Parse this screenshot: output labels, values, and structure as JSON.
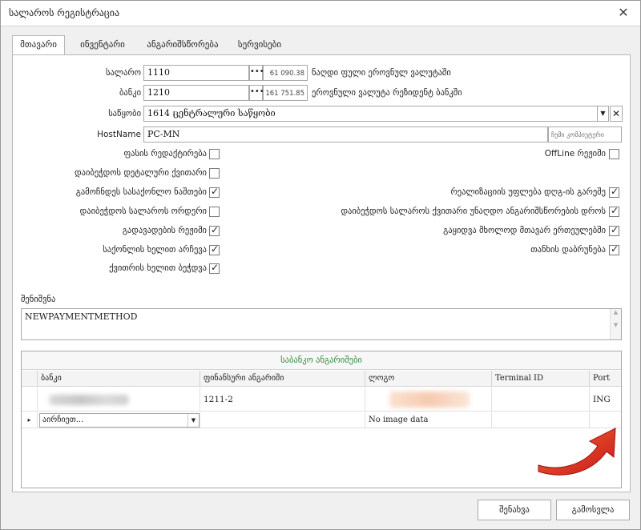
{
  "window": {
    "title": "სალაროს რეგისტრაცია",
    "close_glyph": "✕"
  },
  "tabs": [
    {
      "label": "მთავარი"
    },
    {
      "label": "ინვენტარი"
    },
    {
      "label": "ანგარიშსწორება"
    },
    {
      "label": "სერვისები"
    }
  ],
  "fields": {
    "salaro": {
      "label": "სალარო",
      "value": "1110",
      "amount": "61 090.38 ₾",
      "description": "ნაღდი ფული ეროვნულ ვალუტაში"
    },
    "banki": {
      "label": "ბანკი",
      "value": "1210",
      "amount": "161 751.85 ₾",
      "description": "ეროვნული ვალუტა რეზიდენტ ბანკში"
    },
    "sawyobi": {
      "label": "საწყობი",
      "value": "1614   ცენტრალური საწყობი"
    },
    "hostname": {
      "label": "HostName",
      "value": "PC-MN",
      "hint": "ჩემი კომპიუტერი"
    }
  },
  "dots_glyph": "•••",
  "combo_arrow": "▼",
  "clear_glyph": "✕",
  "left_checks": [
    {
      "label": "ფასის რედაქტირება",
      "checked": false
    },
    {
      "label": "დაიბეჭდოს დეტალური ქვითარი",
      "checked": false
    },
    {
      "label": "გამოჩნდეს სასაქონლო ნაშთები",
      "checked": true
    },
    {
      "label": "დაიბეჭდოს სალაროს ორდერი",
      "checked": false
    },
    {
      "label": "გადავადების რეჟიმი",
      "checked": true
    },
    {
      "label": "საქონლის ხელით არჩევა",
      "checked": true
    },
    {
      "label": "ქვითრის ხელით ბეჭდვა",
      "checked": true
    }
  ],
  "right_checks": [
    {
      "label": "OffLine რეჟიმი",
      "checked": false
    },
    {
      "label": "რეალიზაციის უფლება დღგ-ის გარეშე",
      "checked": true
    },
    {
      "label": "დაიბეჭდოს სალაროს ქვითარი უნაღდო ანგარიშსწორების დროს",
      "checked": true
    },
    {
      "label": "გაყიდვა მხოლოდ მთავარ ერთეულებში",
      "checked": true
    },
    {
      "label": "თანხის დაბრუნება",
      "checked": true
    }
  ],
  "notes": {
    "label": "შენიშვნა",
    "value": "NEWPAYMENTMETHOD"
  },
  "bank_grid": {
    "title": "საბანკო ანგარიშები",
    "columns": [
      "ბანკი",
      "ფინანსური ანგარიში",
      "ლოგო",
      "Terminal ID",
      "Port"
    ],
    "rows": [
      {
        "account": "1211-2",
        "terminal_id": "",
        "port": "ING"
      }
    ],
    "new_row": {
      "bank_placeholder": "აირჩიეთ...",
      "logo": "No image data",
      "row_marker": "▸"
    }
  },
  "buttons": {
    "save": "შენახვა",
    "exit": "გამოსვლა"
  },
  "colors": {
    "grid_title": "#2e8b3c",
    "arrow": "#e8431f"
  }
}
